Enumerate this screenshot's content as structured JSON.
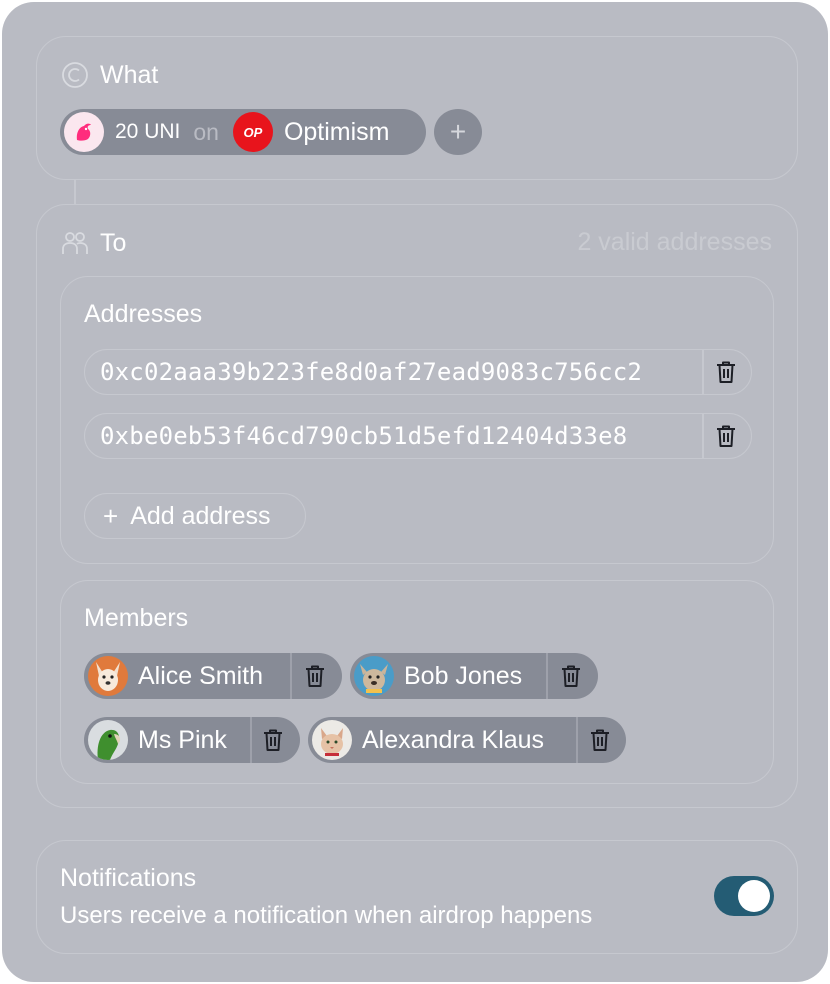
{
  "what": {
    "label": "What",
    "token_amount": "20 UNI",
    "on_word": "on",
    "chain_name": "Optimism",
    "chain_badge": "OP",
    "add_symbol": "+"
  },
  "to": {
    "label": "To",
    "valid_count": "2 valid addresses",
    "addresses_title": "Addresses",
    "addresses": [
      "0xc02aaa39b223fe8d0af27ead9083c756cc2",
      "0xbe0eb53f46cd790cb51d5efd12404d33e8"
    ],
    "add_address_label": "Add address",
    "add_address_symbol": "+",
    "members_title": "Members",
    "members": [
      {
        "name": "Alice Smith",
        "avatar": "dog-avatar"
      },
      {
        "name": "Bob Jones",
        "avatar": "bulldog-avatar"
      },
      {
        "name": "Ms Pink",
        "avatar": "parrot-avatar"
      },
      {
        "name": "Alexandra Klaus",
        "avatar": "cat-avatar"
      }
    ]
  },
  "notifications": {
    "title": "Notifications",
    "description": "Users receive a notification when airdrop happens",
    "enabled": true
  },
  "colors": {
    "card_bg": "#b9bbc3",
    "pill_bg": "#878b96",
    "toggle_on": "#245c74",
    "op_red": "#e8141c"
  }
}
